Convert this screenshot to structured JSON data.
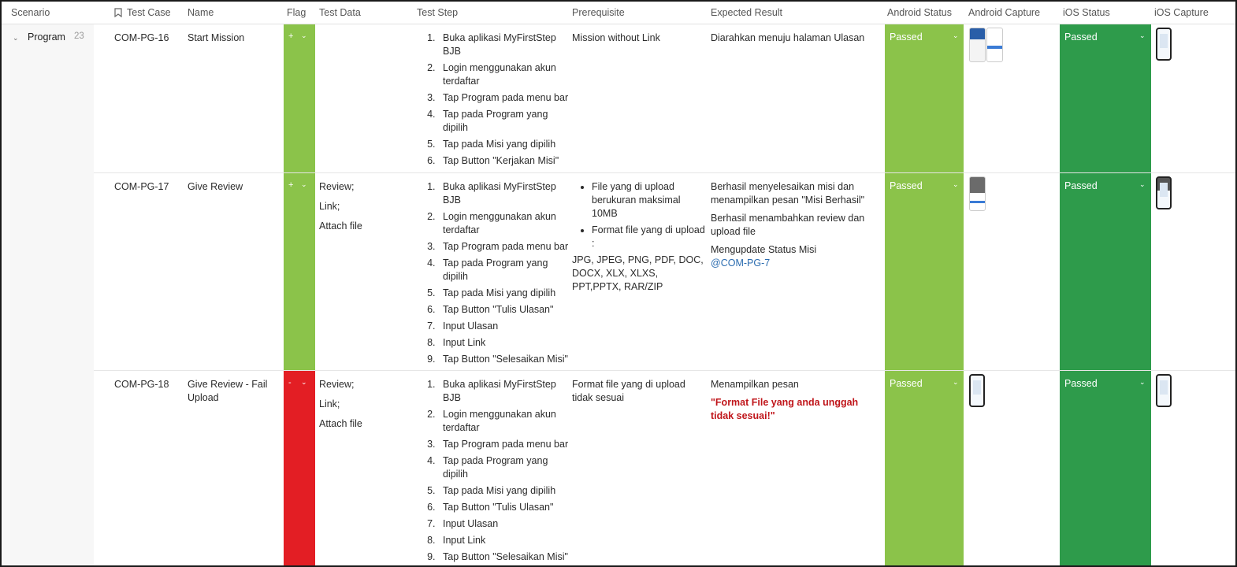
{
  "columns": {
    "scenario": "Scenario",
    "test_case": "Test Case",
    "name": "Name",
    "flag": "Flag",
    "test_data": "Test Data",
    "test_step": "Test Step",
    "prerequisite": "Prerequisite",
    "expected_result": "Expected Result",
    "android_status": "Android Status",
    "android_capture": "Android Capture",
    "ios_status": "iOS Status",
    "ios_capture": "iOS Capture"
  },
  "scenario": {
    "name": "Program",
    "count": "23"
  },
  "colors": {
    "flag_plus": "#8bc34a",
    "flag_minus": "#e31e24",
    "android_passed": "#8bc34a",
    "ios_passed": "#2e9b4b",
    "error_text": "#c0161b",
    "link": "#2b6cb0"
  },
  "rows": [
    {
      "id": "COM-PG-16",
      "name": "Start Mission",
      "flag": "+",
      "test_data": [],
      "steps": [
        "Buka aplikasi MyFirstStep BJB",
        "Login menggunakan akun terdaftar",
        "Tap Program pada menu bar",
        "Tap pada Program yang dipilih",
        "Tap pada Misi yang dipilih",
        "Tap Button \"Kerjakan Misi\""
      ],
      "prerequisite": "Mission without Link",
      "expected": [
        "Diarahkan menuju halaman Ulasan"
      ],
      "android_status": "Passed",
      "ios_status": "Passed"
    },
    {
      "id": "COM-PG-17",
      "name": "Give Review",
      "flag": "+",
      "test_data": [
        "Review;",
        "Link;",
        "Attach file"
      ],
      "steps": [
        "Buka aplikasi MyFirstStep BJB",
        "Login menggunakan akun terdaftar",
        "Tap Program pada menu bar",
        "Tap pada Program yang dipilih",
        "Tap pada Misi yang dipilih",
        "Tap Button \"Tulis Ulasan\"",
        "Input Ulasan",
        "Input Link",
        "Tap Button \"Selesaikan Misi\""
      ],
      "prerequisite_bullets": [
        "File yang di upload berukuran maksimal 10MB",
        "Format file yang di upload :"
      ],
      "prerequisite_formats": "JPG, JPEG, PNG, PDF, DOC, DOCX, XLX, XLXS, PPT,PPTX, RAR/ZIP",
      "expected": [
        "Berhasil menyelesaikan misi dan menampilkan pesan \"Misi Berhasil\"",
        "Berhasil menambahkan review dan upload file",
        "Mengupdate Status Misi"
      ],
      "expected_link": "@COM-PG-7",
      "android_status": "Passed",
      "ios_status": "Passed"
    },
    {
      "id": "COM-PG-18",
      "name": "Give Review - Fail Upload",
      "flag": "-",
      "test_data": [
        "Review;",
        "Link;",
        "Attach file"
      ],
      "steps": [
        "Buka aplikasi MyFirstStep BJB",
        "Login menggunakan akun terdaftar",
        "Tap Program pada menu bar",
        "Tap pada Program yang dipilih",
        "Tap pada Misi yang dipilih",
        "Tap Button \"Tulis Ulasan\"",
        "Input Ulasan",
        "Input Link",
        "Tap Button \"Selesaikan Misi\""
      ],
      "prerequisite": "Format file yang di upload tidak sesuai",
      "expected": [
        "Menampilkan pesan"
      ],
      "expected_error": "\"Format File yang anda unggah tidak sesuai!\"",
      "android_status": "Passed",
      "ios_status": "Passed"
    }
  ]
}
